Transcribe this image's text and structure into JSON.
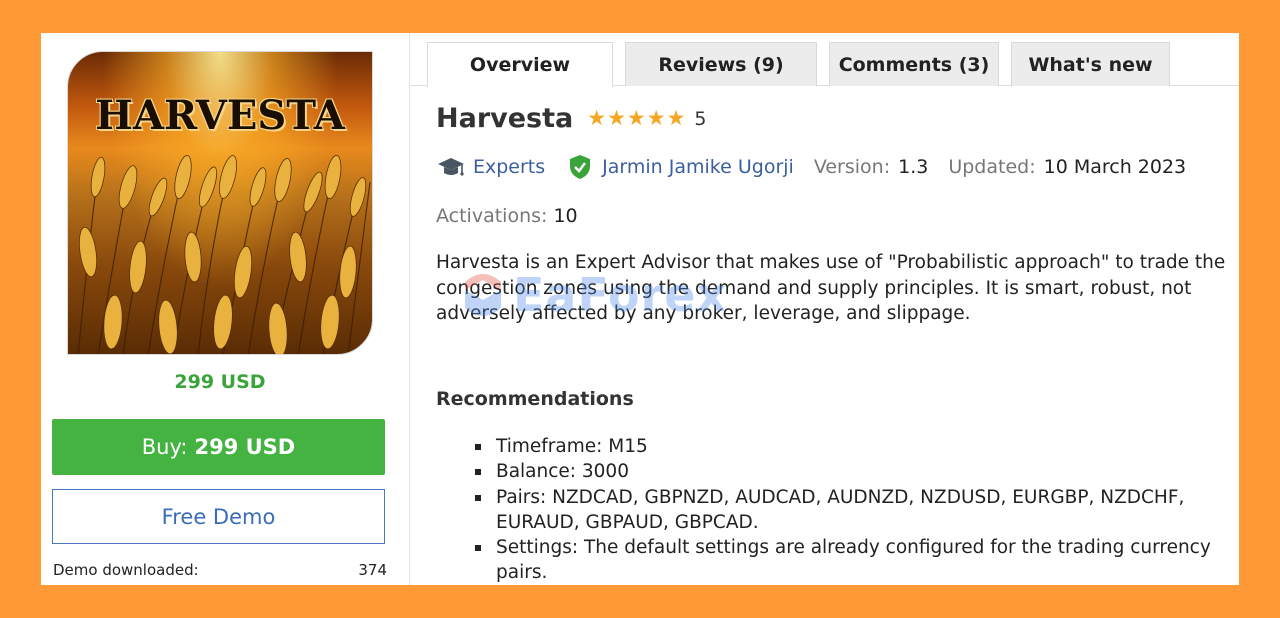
{
  "product": {
    "image_text": "HARVESTA",
    "price": "299 USD",
    "buy_label": "Buy:",
    "buy_price": "299 USD",
    "demo_label": "Free Demo",
    "demo_downloaded_label": "Demo downloaded:",
    "demo_downloaded_count": "374"
  },
  "tabs": [
    {
      "label": "Overview",
      "active": true
    },
    {
      "label": "Reviews (9)",
      "active": false
    },
    {
      "label": "Comments (3)",
      "active": false
    },
    {
      "label": "What's new",
      "active": false
    }
  ],
  "header": {
    "title": "Harvesta",
    "rating": "5",
    "stars": 5
  },
  "meta": {
    "category": "Experts",
    "author": "Jarmin Jamike Ugorji",
    "version_label": "Version:",
    "version": "1.3",
    "updated_label": "Updated:",
    "updated": "10 March 2023",
    "activations_label": "Activations:",
    "activations": "10"
  },
  "description": "Harvesta  is an Expert Advisor that makes use of \"Probabilistic approach\" to trade the congestion zones using the demand and supply principles. It is smart, robust, not adversely affected by any broker, leverage, and slippage.",
  "watermark": "EaForex",
  "recommendations": {
    "title": "Recommendations",
    "items": [
      "Timeframe: M15",
      "Balance: 3000",
      "Pairs: NZDCAD, GBPNZD, AUDCAD, AUDNZD, NZDUSD, EURGBP, NZDCHF, EURAUD, GBPAUD, GBPCAD.",
      "Settings: The default settings are already configured for the trading currency pairs."
    ]
  },
  "colors": {
    "background": "#fd9a35",
    "price_green": "#3aa33a",
    "buy_green": "#45b342",
    "link_blue": "#3b5f9e",
    "star": "#f5a623"
  }
}
